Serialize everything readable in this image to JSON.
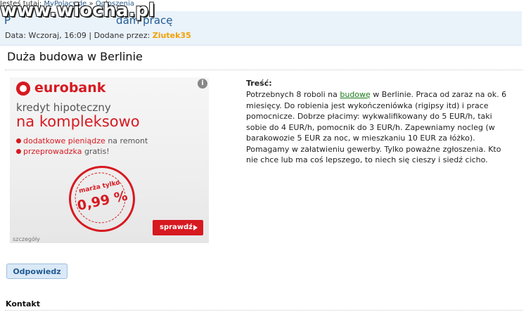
{
  "breadcrumb": {
    "prefix": "Jesteś tutaj:",
    "items": [
      "MyPolacy.de",
      "Ogłoszenia"
    ],
    "separator": "»"
  },
  "header": {
    "watermark": "www.wiocha.pl",
    "title_left": "P",
    "title_right": "dam pracę",
    "meta_prefix": "Data: Wczoraj, 16:09 | Dodane przez:",
    "author": "Ziutek35"
  },
  "ad": {
    "title": "Duża budowa w Berlinie",
    "sponsor": {
      "brand": "eurobank",
      "line1": "kredyt hipoteczny",
      "line2": "na kompleksowo",
      "bullet1_red": "dodatkowe pieniądze",
      "bullet1_rest": "na remont",
      "bullet2_red": "przeprowadzka",
      "bullet2_rest": "gratis!",
      "stamp_top": "marża tylko",
      "stamp_rate": "0,99 %",
      "cta": "sprawdź",
      "details": "szczegóły",
      "info": "i"
    }
  },
  "content": {
    "label": "Treść:",
    "text_before": "Potrzebnych 8 roboli na ",
    "link": "budowę",
    "text_after": " w Berlinie. Praca od zaraz na ok. 6 miesięcy. Do robienia jest wykończeniówka (rigipsy itd) i prace pomocnicze. Dobrze płacimy: wykwalifikowany do 5 EUR/h, taki sobie do 4 EUR/h, pomocnik do 3 EUR/h. Zapewniamy nocleg (w barakowozie 5 EUR za noc, w mieszkaniu 10 EUR za łóżko). Pomagamy w załatwieniu gewerby. Tylko poważne zgłoszenia. Kto nie chce lub ma coś lepszego, to niech się cieszy i siedź cicho."
  },
  "actions": {
    "reply_label": "Odpowiedz"
  },
  "footer": {
    "kontakt_label": "Kontakt"
  }
}
